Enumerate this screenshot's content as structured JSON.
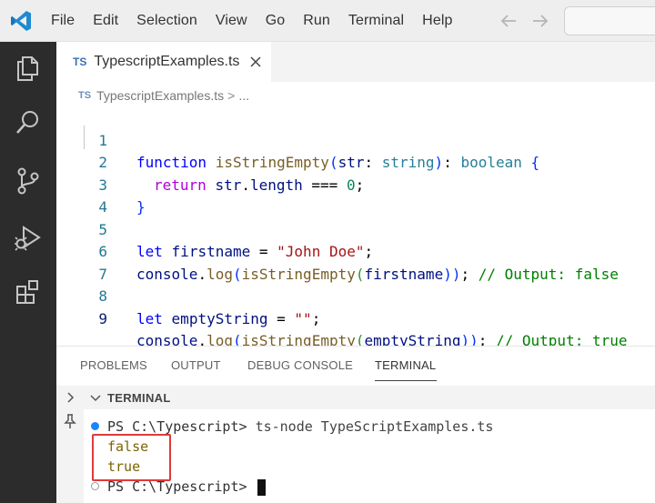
{
  "menu": [
    "File",
    "Edit",
    "Selection",
    "View",
    "Go",
    "Run",
    "Terminal",
    "Help"
  ],
  "tab": {
    "badge": "TS",
    "label": "TypescriptExamples.ts"
  },
  "breadcrumb": {
    "badge": "TS",
    "file": "TypescriptExamples.ts",
    "sep": ">",
    "more": "..."
  },
  "editor": {
    "lines": [
      {
        "n": "1"
      },
      {
        "n": "2"
      },
      {
        "n": "3"
      },
      {
        "n": "4"
      },
      {
        "n": "5"
      },
      {
        "n": "6"
      },
      {
        "n": "7"
      },
      {
        "n": "8"
      },
      {
        "n": "9"
      }
    ],
    "code": {
      "l1": {
        "kw": "function",
        "fn": "isStringEmpty",
        "open": "(",
        "param": "str",
        "colon": ": ",
        "ptype": "string",
        "close": ")",
        "colon2": ": ",
        "rtype": "boolean",
        "brace": " {"
      },
      "l2": {
        "kw": "return",
        "obj": "str",
        "dot": ".",
        "prop": "length",
        "op": " === ",
        "num": "0",
        "semi": ";"
      },
      "l3": {
        "brace": "}"
      },
      "l5": {
        "kw": "let",
        "var": "firstname",
        "eq": " = ",
        "str": "\"John Doe\"",
        "semi": ";"
      },
      "l6": {
        "obj": "console",
        "dot": ".",
        "fn1": "log",
        "p1": "(",
        "fn2": "isStringEmpty",
        "p2": "(",
        "arg": "firstname",
        "p3": "))",
        "semi": "; ",
        "cmt": "// Output: false"
      },
      "l8": {
        "kw": "let",
        "var": "emptyString",
        "eq": " = ",
        "str": "\"\"",
        "semi": ";"
      },
      "l9": {
        "obj": "console",
        "dot": ".",
        "fn1": "log",
        "p1": "(",
        "fn2": "isStringEmpty",
        "p2": "(",
        "arg": "emptyString",
        "p3": "))",
        "semi": "; ",
        "cmt": "// Output: true"
      }
    }
  },
  "panel": {
    "tabs": [
      "PROBLEMS",
      "OUTPUT",
      "DEBUG CONSOLE",
      "TERMINAL"
    ],
    "active_tab": "TERMINAL",
    "section_title": "TERMINAL"
  },
  "terminal": {
    "prompt1": "PS C:\\Typescript> ",
    "command": "ts-node TypeScriptExamples.ts",
    "out1": "false",
    "out2": "true",
    "prompt2": "PS C:\\Typescript> "
  },
  "colors": {
    "activity_bar": "#2c2c2c",
    "keyword": "#0000ff",
    "control_keyword": "#af00db",
    "function": "#795e26",
    "variable": "#001080",
    "type": "#267f99",
    "string": "#a31515",
    "number": "#098658",
    "comment": "#008000",
    "highlight_box": "#e03a3a"
  },
  "icons": [
    "vscode-logo",
    "arrow-left-icon",
    "arrow-right-icon",
    "explorer-icon",
    "search-icon",
    "source-control-icon",
    "run-debug-icon",
    "extensions-icon",
    "close-icon",
    "chevron-right-icon",
    "chevron-down-icon",
    "pin-icon"
  ]
}
